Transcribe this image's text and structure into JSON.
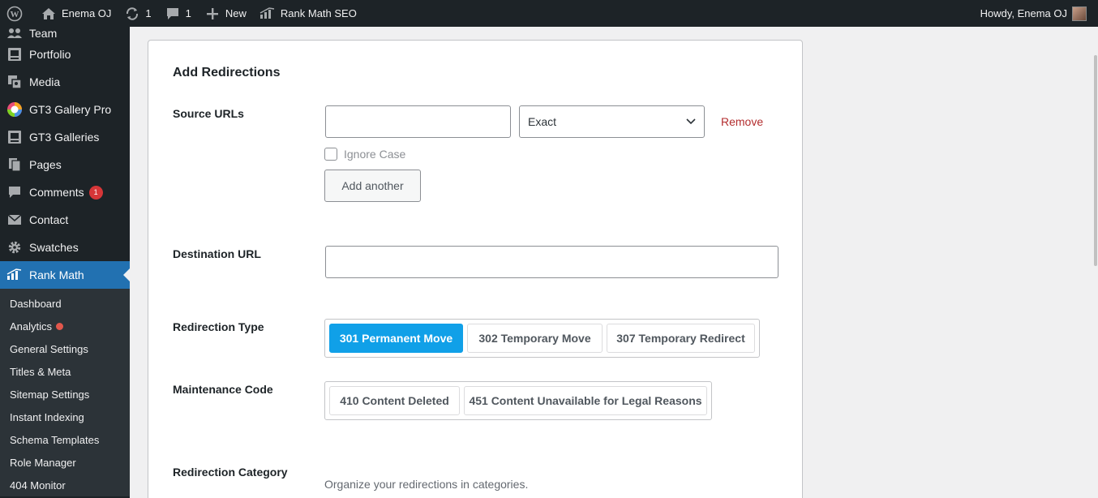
{
  "admin_bar": {
    "site_name": "Enema OJ",
    "updates_count": "1",
    "comments_count": "1",
    "new_label": "New",
    "seo_label": "Rank Math SEO",
    "greeting": "Howdy, Enema OJ"
  },
  "sidebar": {
    "items": [
      {
        "label": "Team",
        "icon": "team-icon"
      },
      {
        "label": "Portfolio",
        "icon": "portfolio-icon"
      },
      {
        "label": "Media",
        "icon": "media-icon"
      },
      {
        "label": "GT3 Gallery Pro",
        "icon": "gallery-pro-icon"
      },
      {
        "label": "GT3 Galleries",
        "icon": "galleries-icon"
      },
      {
        "label": "Pages",
        "icon": "pages-icon"
      },
      {
        "label": "Comments",
        "icon": "comments-icon",
        "badge": "1"
      },
      {
        "label": "Contact",
        "icon": "mail-icon"
      },
      {
        "label": "Swatches",
        "icon": "gear-icon"
      },
      {
        "label": "Rank Math",
        "icon": "rank-math-icon",
        "active": true
      }
    ],
    "submenu": [
      "Dashboard",
      "Analytics",
      "General Settings",
      "Titles & Meta",
      "Sitemap Settings",
      "Instant Indexing",
      "Schema Templates",
      "Role Manager",
      "404 Monitor"
    ]
  },
  "form": {
    "title": "Add Redirections",
    "source_label": "Source URLs",
    "source_value": "",
    "match_type": "Exact",
    "remove_label": "Remove",
    "ignore_case_label": "Ignore Case",
    "ignore_case_checked": false,
    "add_another_label": "Add another",
    "destination_label": "Destination URL",
    "destination_value": "",
    "redirection_type_label": "Redirection Type",
    "redirection_types": [
      "301 Permanent Move",
      "302 Temporary Move",
      "307 Temporary Redirect"
    ],
    "redirection_type_selected": "301 Permanent Move",
    "maintenance_label": "Maintenance Code",
    "maintenance_codes": [
      "410 Content Deleted",
      "451 Content Unavailable for Legal Reasons"
    ],
    "category_label": "Redirection Category",
    "category_help": "Organize your redirections in categories."
  },
  "colors": {
    "admin_bg": "#1d2327",
    "active_menu": "#2271b1",
    "selected_button": "#10a0e8",
    "remove_link": "#b32d2e",
    "badge": "#d63638"
  }
}
